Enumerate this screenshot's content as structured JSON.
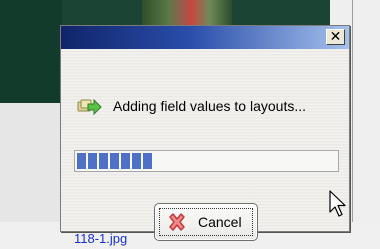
{
  "background": {
    "file_label": "118-1.jpg"
  },
  "dialog": {
    "close_symbol": "✕",
    "status_icon": "add-fields-arrow-icon",
    "status_text": "Adding field values to layouts...",
    "progress_fraction": 0.29,
    "cancel_label": "Cancel",
    "cancel_icon": "red-x-icon",
    "colors": {
      "titlebar_start": "#10246a",
      "titlebar_end": "#a6c2ec",
      "progress": "#4e70c6"
    }
  }
}
